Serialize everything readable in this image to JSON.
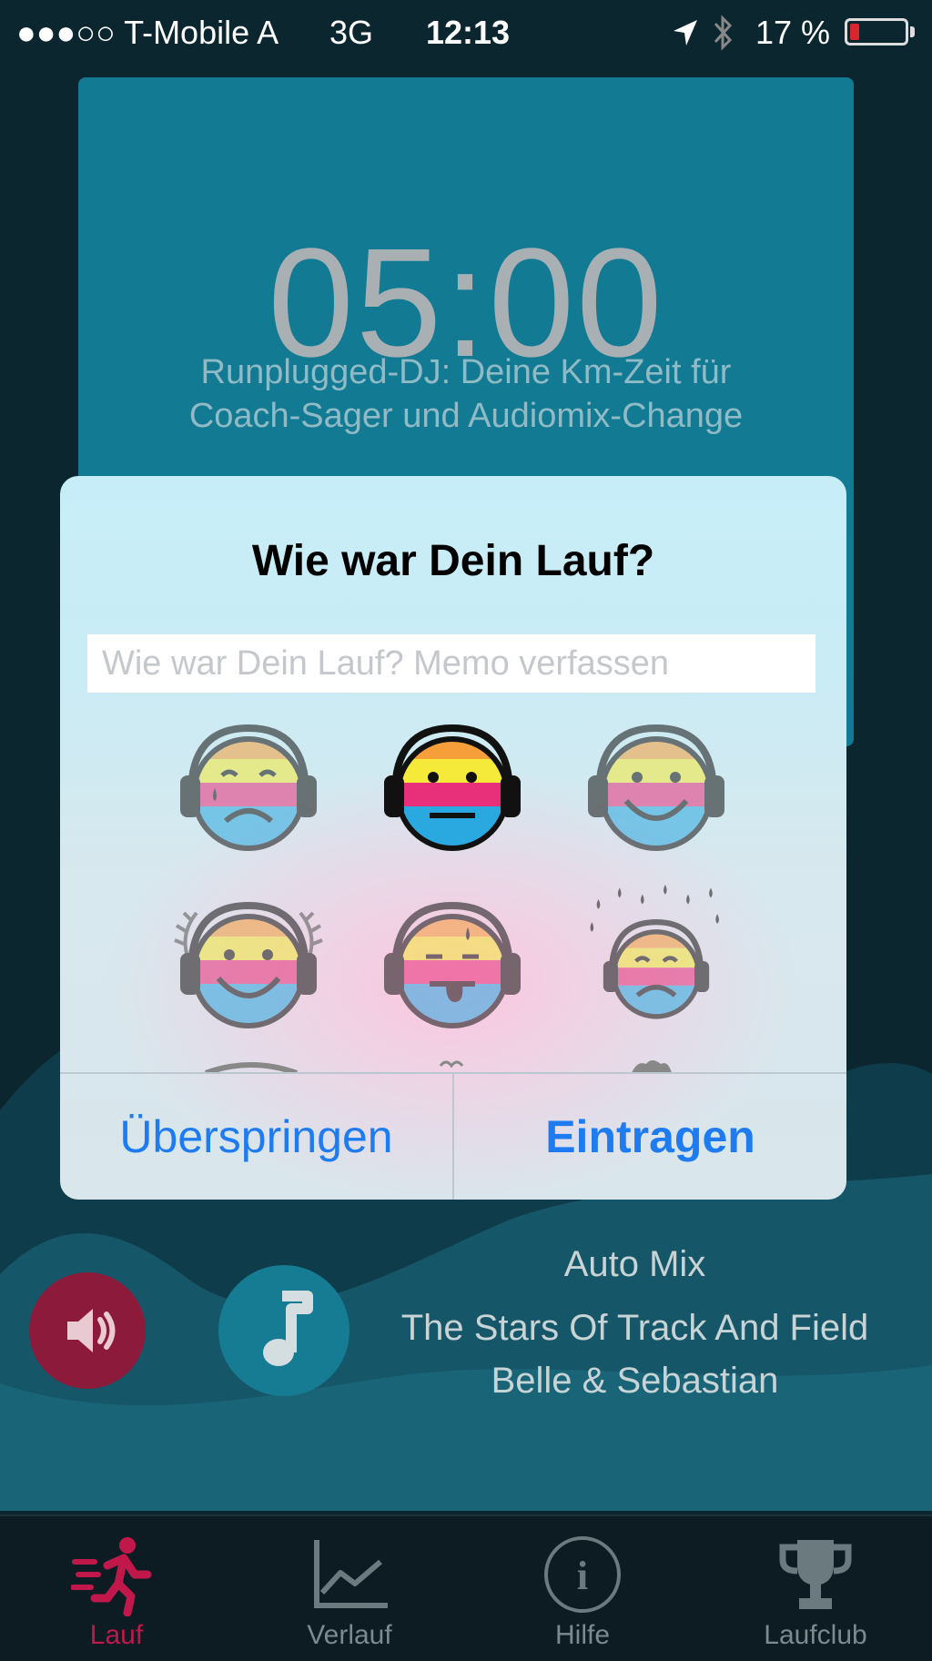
{
  "status_bar": {
    "carrier": "●●●○○ T-Mobile A",
    "network": "3G",
    "time": "12:13",
    "battery": "17 %",
    "battery_level": 0.17,
    "icons": [
      "location-arrow-icon",
      "bluetooth-icon",
      "battery-icon"
    ]
  },
  "timer": {
    "value": "05:00",
    "subtitle_line1": "Runplugged-DJ: Deine Km-Zeit für",
    "subtitle_line2": "Coach-Sager und Audiomix-Change"
  },
  "dialog": {
    "title": "Wie war Dein Lauf?",
    "memo_placeholder": "Wie war Dein Lauf? Memo verfassen",
    "memo_value": "",
    "moods": [
      {
        "name": "mood-sad-tear",
        "selected": false
      },
      {
        "name": "mood-neutral",
        "selected": true
      },
      {
        "name": "mood-happy",
        "selected": false
      },
      {
        "name": "mood-winner",
        "selected": false
      },
      {
        "name": "mood-exhausted",
        "selected": false
      },
      {
        "name": "mood-rain",
        "selected": false
      }
    ],
    "skip_label": "Überspringen",
    "submit_label": "Eintragen"
  },
  "player": {
    "mode": "Auto Mix",
    "track": "The Stars Of Track And Field",
    "artist": "Belle & Sebastian",
    "icons": [
      "speaker-icon",
      "music-note-icon"
    ]
  },
  "tabs": [
    {
      "label": "Lauf",
      "icon": "runner-icon",
      "active": true
    },
    {
      "label": "Verlauf",
      "icon": "chart-icon",
      "active": false
    },
    {
      "label": "Hilfe",
      "icon": "info-icon",
      "active": false
    },
    {
      "label": "Laufclub",
      "icon": "trophy-icon",
      "active": false
    }
  ],
  "colors": {
    "background": "#0c2630",
    "timer_card": "#127a92",
    "accent_red": "#c0184a",
    "button_blue": "#1f7cf0"
  }
}
